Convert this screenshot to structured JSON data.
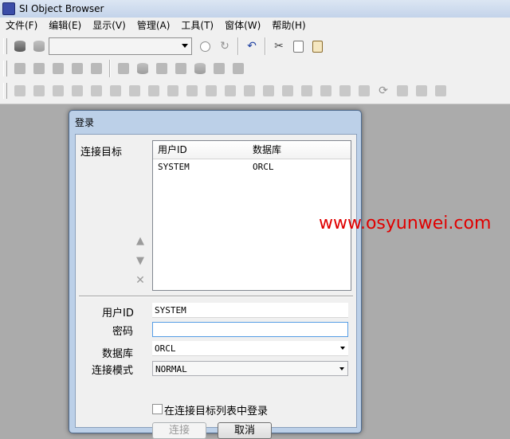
{
  "window": {
    "title": "SI Object Browser"
  },
  "menu": [
    "文件(F)",
    "编辑(E)",
    "显示(V)",
    "管理(A)",
    "工具(T)",
    "窗体(W)",
    "帮助(H)"
  ],
  "toolbar": {
    "row1": [
      "database-connect-icon",
      "database-disconnect-icon",
      "connection-combo",
      "radio",
      "refresh-icon",
      "undo-icon",
      "cut-icon",
      "copy-icon",
      "paste-icon"
    ],
    "row2_count": 10,
    "row3_count": 21
  },
  "dialog": {
    "title": "登录",
    "targets_label": "连接目标",
    "columns": [
      "用户ID",
      "数据库"
    ],
    "rows": [
      {
        "user_id": "SYSTEM",
        "database": "ORCL"
      }
    ],
    "user_id_label": "用户ID",
    "user_id_value": "SYSTEM",
    "password_label": "密码",
    "password_value": "",
    "database_label": "数据库",
    "database_value": "ORCL",
    "mode_label": "连接模式",
    "mode_value": "NORMAL",
    "checkbox_label": "在连接目标列表中登录",
    "checkbox_checked": false,
    "connect_button": "连接",
    "cancel_button": "取消"
  },
  "watermark": "www.osyunwei.com"
}
